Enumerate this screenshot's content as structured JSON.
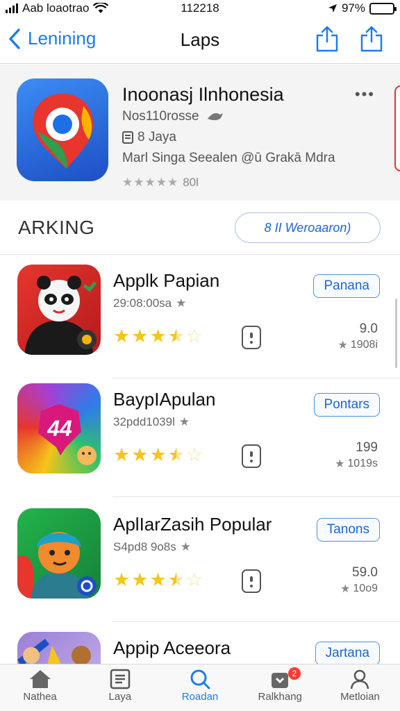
{
  "status_bar": {
    "carrier": "Aab loaotrao",
    "time": "112218",
    "battery": "97%",
    "battery_level": 0.97
  },
  "nav": {
    "back_label": "Lenining",
    "title": "Laps"
  },
  "featured": {
    "title": "Inoonasj Ilnhonesia",
    "subtitle": "Nos110rosse",
    "meta": "8 Jaya",
    "developer": "Marl Singa Seealen @ū Grakā Mdra",
    "rating_count": "80l",
    "more": "•••"
  },
  "section": {
    "title": "ARKING",
    "button_label": "8 II Weroaaron)"
  },
  "apps": [
    {
      "name": "Applk Papian",
      "subtitle": "29:08:00sa",
      "button": "Panana",
      "size": "9.0",
      "count": "1908i",
      "stars": 3.5
    },
    {
      "name": "BaypIApulan",
      "subtitle": "32pdd1039l",
      "button": "Pontars",
      "size": "199",
      "count": "1019s",
      "stars": 3.5
    },
    {
      "name": "AplIarZasih Popular",
      "subtitle": "S4pd8 9o8s",
      "button": "Tanons",
      "size": "59.0",
      "count": "10o9",
      "stars": 3.5
    },
    {
      "name": "Appip Aceeora",
      "subtitle": "",
      "button": "Jartana",
      "size": "",
      "count": "",
      "stars": 0
    }
  ],
  "tabs": [
    {
      "label": "Nathea",
      "icon": "home-icon"
    },
    {
      "label": "Laya",
      "icon": "list-icon"
    },
    {
      "label": "Roadan",
      "icon": "search-icon"
    },
    {
      "label": "Ralkhang",
      "icon": "updates-icon",
      "badge": "2"
    },
    {
      "label": "Metloian",
      "icon": "person-icon"
    }
  ],
  "colors": {
    "accent": "#1a7bf2",
    "star": "#f5c518",
    "badge": "#ff3b30"
  }
}
